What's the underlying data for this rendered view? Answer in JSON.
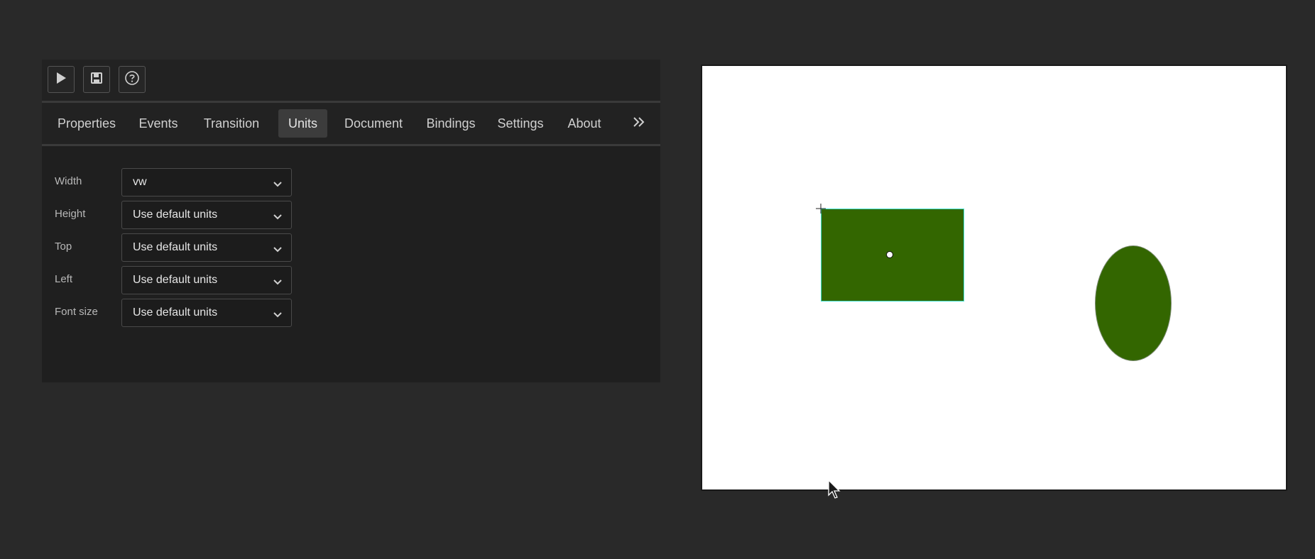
{
  "toolbar": {
    "buttons": [
      {
        "name": "play-button",
        "icon": "play-icon"
      },
      {
        "name": "save-button",
        "icon": "save-icon"
      },
      {
        "name": "help-button",
        "icon": "help-icon"
      }
    ]
  },
  "tabs": {
    "items": [
      {
        "label": "Properties"
      },
      {
        "label": "Events"
      },
      {
        "label": "Transition"
      },
      {
        "label": "Units",
        "active": true
      },
      {
        "label": "Document"
      },
      {
        "label": "Bindings"
      },
      {
        "label": "Settings"
      },
      {
        "label": "About"
      }
    ],
    "overflow_icon": "double-chevron-right-icon"
  },
  "units_form": {
    "rows": [
      {
        "label": "Width",
        "value": "vw"
      },
      {
        "label": "Height",
        "value": "Use default units"
      },
      {
        "label": "Top",
        "value": "Use default units"
      },
      {
        "label": "Left",
        "value": "Use default units"
      },
      {
        "label": "Font size",
        "value": "Use default units"
      }
    ]
  },
  "canvas": {
    "background": "#ffffff",
    "shapes": [
      {
        "type": "rectangle",
        "fill": "#336600",
        "selected": true,
        "selection_color": "#3fe0d0"
      },
      {
        "type": "ellipse",
        "fill": "#336600",
        "selected": false
      }
    ]
  },
  "colors": {
    "app_background": "#292929",
    "panel_background": "#1f1f1f",
    "active_tab": "#3c3c3c",
    "shape_fill": "#336600"
  }
}
